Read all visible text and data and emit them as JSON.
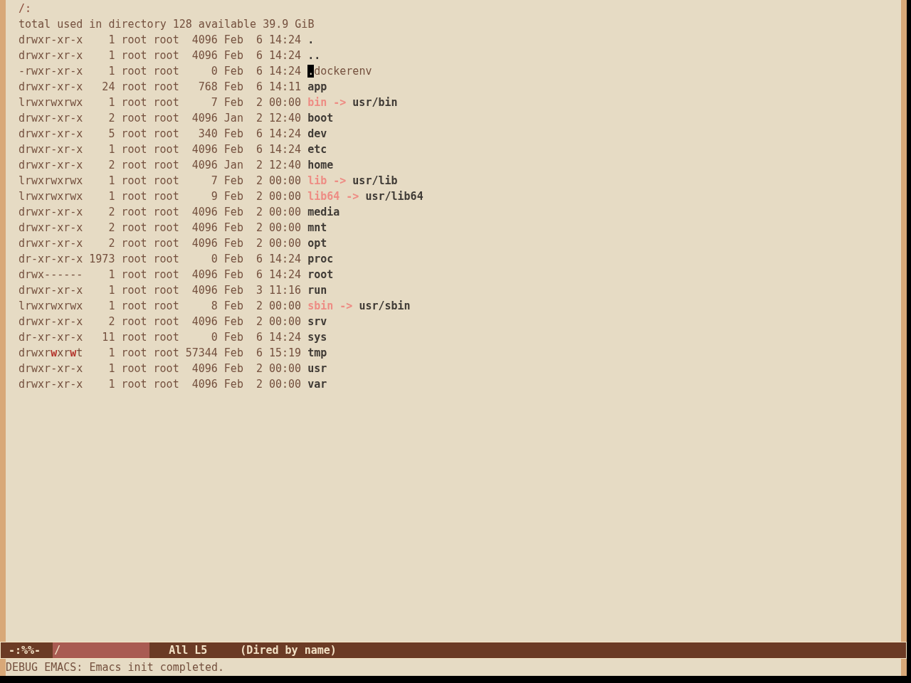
{
  "buffer": {
    "header": "/:",
    "summary": "total used in directory 128 available 39.9 GiB",
    "entries": [
      {
        "kind": "directory",
        "permissions": "drwxr-xr-x",
        "links": "1",
        "owner": "root",
        "group": "root",
        "size": "4096",
        "month": "Feb",
        "day": "6",
        "time": "14:24",
        "name": ".",
        "cursor": false
      },
      {
        "kind": "directory",
        "permissions": "drwxr-xr-x",
        "links": "1",
        "owner": "root",
        "group": "root",
        "size": "4096",
        "month": "Feb",
        "day": "6",
        "time": "14:24",
        "name": "..",
        "cursor": false
      },
      {
        "kind": "file",
        "permissions": "-rwxr-xr-x",
        "links": "1",
        "owner": "root",
        "group": "root",
        "size": "0",
        "month": "Feb",
        "day": "6",
        "time": "14:24",
        "name": ".dockerenv",
        "cursor": true
      },
      {
        "kind": "directory",
        "permissions": "drwxr-xr-x",
        "links": "24",
        "owner": "root",
        "group": "root",
        "size": "768",
        "month": "Feb",
        "day": "6",
        "time": "14:11",
        "name": "app",
        "cursor": false
      },
      {
        "kind": "symlink",
        "permissions": "lrwxrwxrwx",
        "links": "1",
        "owner": "root",
        "group": "root",
        "size": "7",
        "month": "Feb",
        "day": "2",
        "time": "00:00",
        "name": "bin",
        "arrow": "->",
        "target": "usr/bin",
        "cursor": false
      },
      {
        "kind": "directory",
        "permissions": "drwxr-xr-x",
        "links": "2",
        "owner": "root",
        "group": "root",
        "size": "4096",
        "month": "Jan",
        "day": "2",
        "time": "12:40",
        "name": "boot",
        "cursor": false
      },
      {
        "kind": "directory",
        "permissions": "drwxr-xr-x",
        "links": "5",
        "owner": "root",
        "group": "root",
        "size": "340",
        "month": "Feb",
        "day": "6",
        "time": "14:24",
        "name": "dev",
        "cursor": false
      },
      {
        "kind": "directory",
        "permissions": "drwxr-xr-x",
        "links": "1",
        "owner": "root",
        "group": "root",
        "size": "4096",
        "month": "Feb",
        "day": "6",
        "time": "14:24",
        "name": "etc",
        "cursor": false
      },
      {
        "kind": "directory",
        "permissions": "drwxr-xr-x",
        "links": "2",
        "owner": "root",
        "group": "root",
        "size": "4096",
        "month": "Jan",
        "day": "2",
        "time": "12:40",
        "name": "home",
        "cursor": false
      },
      {
        "kind": "symlink",
        "permissions": "lrwxrwxrwx",
        "links": "1",
        "owner": "root",
        "group": "root",
        "size": "7",
        "month": "Feb",
        "day": "2",
        "time": "00:00",
        "name": "lib",
        "arrow": "->",
        "target": "usr/lib",
        "cursor": false
      },
      {
        "kind": "symlink",
        "permissions": "lrwxrwxrwx",
        "links": "1",
        "owner": "root",
        "group": "root",
        "size": "9",
        "month": "Feb",
        "day": "2",
        "time": "00:00",
        "name": "lib64",
        "arrow": "->",
        "target": "usr/lib64",
        "cursor": false
      },
      {
        "kind": "directory",
        "permissions": "drwxr-xr-x",
        "links": "2",
        "owner": "root",
        "group": "root",
        "size": "4096",
        "month": "Feb",
        "day": "2",
        "time": "00:00",
        "name": "media",
        "cursor": false
      },
      {
        "kind": "directory",
        "permissions": "drwxr-xr-x",
        "links": "2",
        "owner": "root",
        "group": "root",
        "size": "4096",
        "month": "Feb",
        "day": "2",
        "time": "00:00",
        "name": "mnt",
        "cursor": false
      },
      {
        "kind": "directory",
        "permissions": "drwxr-xr-x",
        "links": "2",
        "owner": "root",
        "group": "root",
        "size": "4096",
        "month": "Feb",
        "day": "2",
        "time": "00:00",
        "name": "opt",
        "cursor": false
      },
      {
        "kind": "directory",
        "permissions": "dr-xr-xr-x",
        "links": "1973",
        "owner": "root",
        "group": "root",
        "size": "0",
        "month": "Feb",
        "day": "6",
        "time": "14:24",
        "name": "proc",
        "cursor": false
      },
      {
        "kind": "directory",
        "permissions": "drwx------",
        "links": "1",
        "owner": "root",
        "group": "root",
        "size": "4096",
        "month": "Feb",
        "day": "6",
        "time": "14:24",
        "name": "root",
        "cursor": false
      },
      {
        "kind": "directory",
        "permissions": "drwxr-xr-x",
        "links": "1",
        "owner": "root",
        "group": "root",
        "size": "4096",
        "month": "Feb",
        "day": "3",
        "time": "11:16",
        "name": "run",
        "cursor": false
      },
      {
        "kind": "symlink",
        "permissions": "lrwxrwxrwx",
        "links": "1",
        "owner": "root",
        "group": "root",
        "size": "8",
        "month": "Feb",
        "day": "2",
        "time": "00:00",
        "name": "sbin",
        "arrow": "->",
        "target": "usr/sbin",
        "cursor": false
      },
      {
        "kind": "directory",
        "permissions": "drwxr-xr-x",
        "links": "2",
        "owner": "root",
        "group": "root",
        "size": "4096",
        "month": "Feb",
        "day": "2",
        "time": "00:00",
        "name": "srv",
        "cursor": false
      },
      {
        "kind": "directory",
        "permissions": "dr-xr-xr-x",
        "links": "11",
        "owner": "root",
        "group": "root",
        "size": "0",
        "month": "Feb",
        "day": "6",
        "time": "14:24",
        "name": "sys",
        "cursor": false
      },
      {
        "kind": "directory",
        "permissions": "drwxr**w**xr**w**t",
        "links": "1",
        "owner": "root",
        "group": "root",
        "size": "57344",
        "month": "Feb",
        "day": "6",
        "time": "15:19",
        "name": "tmp",
        "cursor": false
      },
      {
        "kind": "directory",
        "permissions": "drwxr-xr-x",
        "links": "1",
        "owner": "root",
        "group": "root",
        "size": "4096",
        "month": "Feb",
        "day": "2",
        "time": "00:00",
        "name": "usr",
        "cursor": false
      },
      {
        "kind": "directory",
        "permissions": "drwxr-xr-x",
        "links": "1",
        "owner": "root",
        "group": "root",
        "size": "4096",
        "month": "Feb",
        "day": "2",
        "time": "00:00",
        "name": "var",
        "cursor": false
      }
    ]
  },
  "mode_line": {
    "status": "-:%%-",
    "buffer_name": "/",
    "position": "All L5",
    "mode": "(Dired by name)"
  },
  "echo_area": {
    "message": "DEBUG EMACS: Emacs init completed."
  }
}
